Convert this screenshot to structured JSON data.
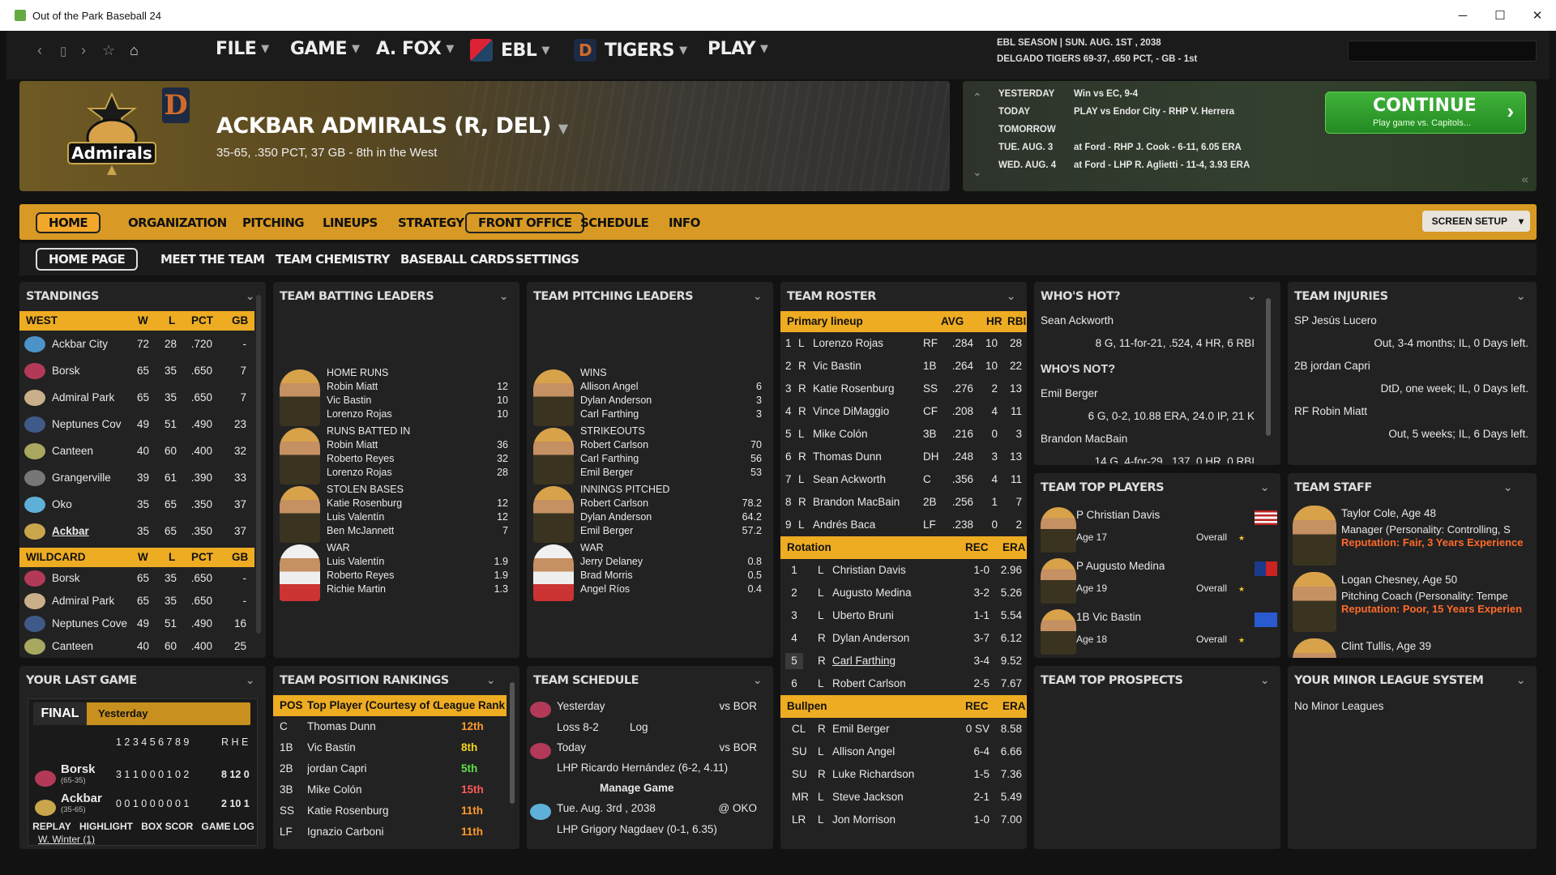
{
  "window": {
    "title": "Out of the Park Baseball 24",
    "min": "─",
    "max": "☐",
    "close": "✕"
  },
  "menu": {
    "file": "FILE",
    "game": "GAME",
    "manager": "A. FOX",
    "league": "EBL",
    "team": "TIGERS",
    "play": "PLAY"
  },
  "season": {
    "line1": "EBL SEASON  |  SUN. AUG. 1ST , 2038",
    "line2": "DELGADO TIGERS  69-37, .650 PCT, - GB - 1st"
  },
  "search": {
    "placeholder": ""
  },
  "banner": {
    "team_name": "ACKBAR ADMIRALS (R, DEL)",
    "record": "35-65, .350 PCT, 37 GB - 8th in the West",
    "logo_text": "Admirals",
    "parent_logo": "D"
  },
  "schedule_strip": {
    "rows": [
      {
        "day": "YESTERDAY",
        "text": "Win vs EC, 9-4"
      },
      {
        "day": "TODAY",
        "text": "PLAY vs Endor City - RHP V. Herrera"
      },
      {
        "day": "TOMORROW",
        "text": ""
      },
      {
        "day": "TUE. AUG. 3",
        "text": "at Ford - RHP J. Cook - 6-11, 6.05 ERA"
      },
      {
        "day": "WED. AUG. 4",
        "text": "at Ford - LHP R. Aglietti - 11-4, 3.93 ERA"
      }
    ],
    "continue_label": "CONTINUE",
    "continue_sub": "Play game vs. Capitols...",
    "continue_arrow": "›"
  },
  "tabs": [
    "HOME",
    "ORGANIZATION",
    "PITCHING",
    "LINEUPS",
    "STRATEGY",
    "FRONT OFFICE",
    "SCHEDULE",
    "INFO"
  ],
  "screen_setup": "SCREEN SETUP",
  "subtabs": [
    "HOME PAGE",
    "MEET THE TEAM",
    "TEAM CHEMISTRY",
    "BASEBALL CARDS",
    "SETTINGS"
  ],
  "standings": {
    "title": "STANDINGS",
    "west_header": [
      "WEST",
      "W",
      "L",
      "PCT",
      "GB"
    ],
    "west": [
      {
        "team": "Ackbar City",
        "w": "72",
        "l": "28",
        "pct": ".720",
        "gb": "-",
        "color": "#4b93c8"
      },
      {
        "team": "Borsk",
        "w": "65",
        "l": "35",
        "pct": ".650",
        "gb": "7",
        "color": "#b23a58"
      },
      {
        "team": "Admiral Park",
        "w": "65",
        "l": "35",
        "pct": ".650",
        "gb": "7",
        "color": "#c9b08a"
      },
      {
        "team": "Neptunes Cov",
        "w": "49",
        "l": "51",
        "pct": ".490",
        "gb": "23",
        "color": "#3f5a88"
      },
      {
        "team": "Canteen",
        "w": "40",
        "l": "60",
        "pct": ".400",
        "gb": "32",
        "color": "#a8a860"
      },
      {
        "team": "Grangerville",
        "w": "39",
        "l": "61",
        "pct": ".390",
        "gb": "33",
        "color": "#777"
      },
      {
        "team": "Oko",
        "w": "35",
        "l": "65",
        "pct": ".350",
        "gb": "37",
        "color": "#5fb0d8"
      },
      {
        "team": "Ackbar",
        "w": "35",
        "l": "65",
        "pct": ".350",
        "gb": "37",
        "color": "#c9a64c"
      }
    ],
    "wild_header": [
      "WILDCARD",
      "W",
      "L",
      "PCT",
      "GB"
    ],
    "wild": [
      {
        "team": "Borsk",
        "w": "65",
        "l": "35",
        "pct": ".650",
        "gb": "-",
        "color": "#b23a58"
      },
      {
        "team": "Admiral Park",
        "w": "65",
        "l": "35",
        "pct": ".650",
        "gb": "-",
        "color": "#c9b08a"
      },
      {
        "team": "Neptunes Cove",
        "w": "49",
        "l": "51",
        "pct": ".490",
        "gb": "16",
        "color": "#3f5a88"
      },
      {
        "team": "Canteen",
        "w": "40",
        "l": "60",
        "pct": ".400",
        "gb": "25",
        "color": "#a8a860"
      }
    ]
  },
  "batting": {
    "title": "TEAM BATTING LEADERS",
    "groups": [
      {
        "cat": "HOME RUNS",
        "rows": [
          [
            "Robin Miatt",
            "12"
          ],
          [
            "Vic Bastin",
            "10"
          ],
          [
            "Lorenzo Rojas",
            "10"
          ]
        ]
      },
      {
        "cat": "RUNS BATTED IN",
        "rows": [
          [
            "Robin Miatt",
            "36"
          ],
          [
            "Roberto Reyes",
            "32"
          ],
          [
            "Lorenzo Rojas",
            "28"
          ]
        ]
      },
      {
        "cat": "STOLEN BASES",
        "rows": [
          [
            "Katie Rosenburg",
            "12"
          ],
          [
            "Luis Valentín",
            "12"
          ],
          [
            "Ben McJannett",
            "7"
          ]
        ]
      },
      {
        "cat": "WAR",
        "rows": [
          [
            "Luis Valentín",
            "1.9"
          ],
          [
            "Roberto Reyes",
            "1.9"
          ],
          [
            "Richie Martin",
            "1.3"
          ]
        ]
      }
    ]
  },
  "pitching": {
    "title": "TEAM PITCHING LEADERS",
    "groups": [
      {
        "cat": "WINS",
        "rows": [
          [
            "Allison Angel",
            "6"
          ],
          [
            "Dylan Anderson",
            "3"
          ],
          [
            "Carl Farthing",
            "3"
          ]
        ]
      },
      {
        "cat": "STRIKEOUTS",
        "rows": [
          [
            "Robert Carlson",
            "70"
          ],
          [
            "Carl Farthing",
            "56"
          ],
          [
            "Emil Berger",
            "53"
          ]
        ]
      },
      {
        "cat": "INNINGS PITCHED",
        "rows": [
          [
            "Robert Carlson",
            "78.2"
          ],
          [
            "Dylan Anderson",
            "64.2"
          ],
          [
            "Emil Berger",
            "57.2"
          ]
        ]
      },
      {
        "cat": "WAR",
        "rows": [
          [
            "Jerry Delaney",
            "0.8"
          ],
          [
            "Brad Morris",
            "0.5"
          ],
          [
            "Angel Ríos",
            "0.4"
          ]
        ]
      }
    ]
  },
  "roster": {
    "title": "TEAM ROSTER",
    "lineup_header": [
      "Primary lineup",
      "AVG",
      "HR",
      "RBI"
    ],
    "lineup": [
      [
        "1",
        "L",
        "Lorenzo Rojas",
        "RF",
        ".284",
        "10",
        "28"
      ],
      [
        "2",
        "R",
        "Vic Bastin",
        "1B",
        ".264",
        "10",
        "22"
      ],
      [
        "3",
        "R",
        "Katie Rosenburg",
        "SS",
        ".276",
        "2",
        "13"
      ],
      [
        "4",
        "R",
        "Vince DiMaggio",
        "CF",
        ".208",
        "4",
        "11"
      ],
      [
        "5",
        "L",
        "Mike Colón",
        "3B",
        ".216",
        "0",
        "3"
      ],
      [
        "6",
        "R",
        "Thomas Dunn",
        "DH",
        ".248",
        "3",
        "13"
      ],
      [
        "7",
        "L",
        "Sean Ackworth",
        "C",
        ".356",
        "4",
        "11"
      ],
      [
        "8",
        "R",
        "Brandon MacBain",
        "2B",
        ".256",
        "1",
        "7"
      ],
      [
        "9",
        "L",
        "Andrés Baca",
        "LF",
        ".238",
        "0",
        "2"
      ]
    ],
    "rotation_header": [
      "Rotation",
      "REC",
      "ERA"
    ],
    "rotation": [
      [
        "1",
        "L",
        "Christian Davis",
        "1-0",
        "2.96"
      ],
      [
        "2",
        "L",
        "Augusto Medina",
        "3-2",
        "5.26"
      ],
      [
        "3",
        "L",
        "Uberto Bruni",
        "1-1",
        "5.54"
      ],
      [
        "4",
        "R",
        "Dylan Anderson",
        "3-7",
        "6.12"
      ],
      [
        "5",
        "R",
        "Carl Farthing",
        "3-4",
        "9.52"
      ],
      [
        "6",
        "L",
        "Robert Carlson",
        "2-5",
        "7.67"
      ]
    ],
    "bullpen_header": [
      "Bullpen",
      "REC",
      "ERA"
    ],
    "bullpen": [
      [
        "CL",
        "R",
        "Emil Berger",
        "0 SV",
        "8.58"
      ],
      [
        "SU",
        "L",
        "Allison Angel",
        "6-4",
        "6.66"
      ],
      [
        "SU",
        "R",
        "Luke Richardson",
        "1-5",
        "7.36"
      ],
      [
        "MR",
        "L",
        "Steve Jackson",
        "2-1",
        "5.49"
      ],
      [
        "LR",
        "L",
        "Jon Morrison",
        "1-0",
        "7.00"
      ]
    ]
  },
  "hot": {
    "title": "WHO'S HOT?",
    "hot_name": "Sean Ackworth",
    "hot_line": "8 G, 11-for-21, .524, 4 HR, 6 RBI",
    "not_title": "WHO'S NOT?",
    "not": [
      {
        "name": "Emil Berger",
        "line": "6 G, 0-2, 10.88 ERA, 24.0 IP, 21 K"
      },
      {
        "name": "Brandon MacBain",
        "line": "14 G, 4-for-29, .137, 0 HR, 0 RBI"
      }
    ]
  },
  "injuries": {
    "title": "TEAM INJURIES",
    "items": [
      {
        "name": "SP Jesús Lucero",
        "detail": "Out, 3-4 months; IL, 0 Days left."
      },
      {
        "name": "2B jordan Capri",
        "detail": "DtD, one week; IL, 0 Days left."
      },
      {
        "name": "RF Robin Miatt",
        "detail": "Out, 5 weeks; IL, 6 Days left."
      }
    ]
  },
  "top_players": {
    "title": "TEAM TOP PLAYERS",
    "overall": "Overall",
    "items": [
      {
        "name": "P Christian Davis",
        "age": "Age 17"
      },
      {
        "name": "P Augusto Medina",
        "age": "Age 19"
      },
      {
        "name": "1B Vic Bastin",
        "age": "Age 18"
      }
    ]
  },
  "staff": {
    "title": "TEAM STAFF",
    "items": [
      {
        "name": "Taylor Cole, Age 48",
        "role": "Manager (Personality: Controlling, S",
        "rep": "Reputation: Fair, 3 Years Experience"
      },
      {
        "name": "Logan Chesney, Age 50",
        "role": "Pitching Coach (Personality: Tempe",
        "rep": "Reputation: Poor, 15 Years Experien"
      },
      {
        "name": "Clint Tullis, Age 39",
        "role": "",
        "rep": ""
      }
    ]
  },
  "last_game": {
    "title": "YOUR LAST GAME",
    "final": "FINAL",
    "when": "Yesterday",
    "innings": "1 2 3 4 5 6 7 8 9",
    "rhe": "R H E",
    "away": {
      "team": "Borsk",
      "rec": "(65-35)",
      "line": "3 1 1 0 0 0 1 0 2",
      "rhe": "8 12 0"
    },
    "home": {
      "team": "Ackbar",
      "rec": "(35-65)",
      "line": "0 0 1 0 0 0 0 0 1",
      "rhe": "2 10 1"
    },
    "footer": "W. Winter (1)",
    "buttons": [
      "REPLAY",
      "HIGHLIGHT",
      "BOX SCOR",
      "GAME LOG"
    ]
  },
  "rankings": {
    "title": "TEAM POSITION RANKINGS",
    "header": [
      "POS",
      "Top Player (Courtesy of OS",
      "League Rank"
    ],
    "rows": [
      [
        "C",
        "Thomas Dunn",
        "12th",
        "orange"
      ],
      [
        "1B",
        "Vic Bastin",
        "8th",
        "yellow"
      ],
      [
        "2B",
        "jordan Capri",
        "5th",
        "green"
      ],
      [
        "3B",
        "Mike Colón",
        "15th",
        "hi"
      ],
      [
        "SS",
        "Katie Rosenburg",
        "11th",
        "orange"
      ],
      [
        "LF",
        "Ignazio Carboni",
        "11th",
        "orange"
      ]
    ]
  },
  "team_schedule": {
    "title": "TEAM SCHEDULE",
    "yesterday": "Yesterday",
    "y_opp": "vs BOR",
    "y_result": "Loss 8-2",
    "y_log": "Log",
    "today": "Today",
    "t_opp": "vs BOR",
    "t_pitch": "LHP Ricardo Hernández (6-2, 4.11)",
    "manage": "Manage Game",
    "next": "Tue. Aug. 3rd , 2038",
    "n_opp": "@ OKO",
    "n_pitch": "LHP Grigory Nagdaev (0-1, 6.35)"
  },
  "prospects": {
    "title": "TEAM TOP PROSPECTS"
  },
  "minors": {
    "title": "YOUR MINOR LEAGUE SYSTEM",
    "text": "No Minor Leagues"
  }
}
